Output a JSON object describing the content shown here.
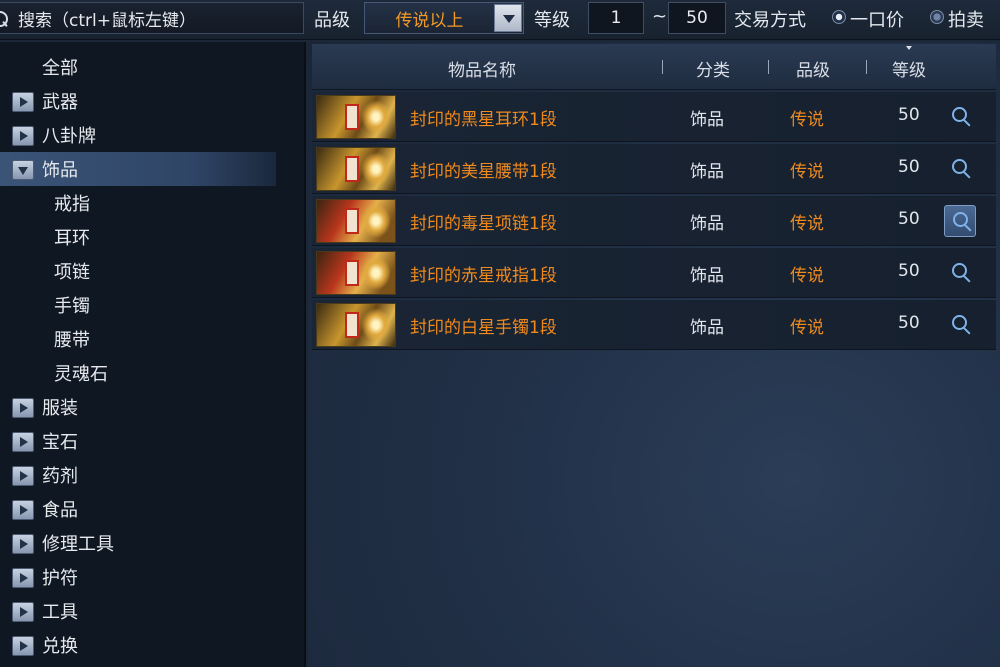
{
  "search": {
    "placeholder": "搜索（ctrl+鼠标左键）"
  },
  "filters": {
    "grade_label": "品级",
    "grade_value": "传说以上",
    "level_label": "等级",
    "level_min": "1",
    "level_sep": "~",
    "level_max": "50",
    "trade_label": "交易方式",
    "trade_options": [
      {
        "label": "一口价",
        "selected": true
      },
      {
        "label": "拍卖",
        "selected": false
      }
    ]
  },
  "sidebar": {
    "items": [
      {
        "label": "全部",
        "type": "root",
        "expanded": false
      },
      {
        "label": "武器",
        "type": "category",
        "expanded": false
      },
      {
        "label": "八卦牌",
        "type": "category",
        "expanded": false
      },
      {
        "label": "饰品",
        "type": "category",
        "expanded": true,
        "selected": true
      },
      {
        "label": "戒指",
        "type": "sub"
      },
      {
        "label": "耳环",
        "type": "sub"
      },
      {
        "label": "项链",
        "type": "sub"
      },
      {
        "label": "手镯",
        "type": "sub"
      },
      {
        "label": "腰带",
        "type": "sub"
      },
      {
        "label": "灵魂石",
        "type": "sub"
      },
      {
        "label": "服装",
        "type": "category",
        "expanded": false
      },
      {
        "label": "宝石",
        "type": "category",
        "expanded": false
      },
      {
        "label": "药剂",
        "type": "category",
        "expanded": false
      },
      {
        "label": "食品",
        "type": "category",
        "expanded": false
      },
      {
        "label": "修理工具",
        "type": "category",
        "expanded": false
      },
      {
        "label": "护符",
        "type": "category",
        "expanded": false
      },
      {
        "label": "工具",
        "type": "category",
        "expanded": false
      },
      {
        "label": "兑换",
        "type": "category",
        "expanded": false
      }
    ]
  },
  "table": {
    "headers": {
      "name": "物品名称",
      "category": "分类",
      "grade": "品级",
      "level": "等级"
    },
    "rows": [
      {
        "name": "封印的黑星耳环1段",
        "category": "饰品",
        "grade": "传说",
        "level": "50",
        "thumb": "gold"
      },
      {
        "name": "封印的美星腰带1段",
        "category": "饰品",
        "grade": "传说",
        "level": "50",
        "thumb": "gold"
      },
      {
        "name": "封印的毒星项链1段",
        "category": "饰品",
        "grade": "传说",
        "level": "50",
        "thumb": "red",
        "hovered": true
      },
      {
        "name": "封印的赤星戒指1段",
        "category": "饰品",
        "grade": "传说",
        "level": "50",
        "thumb": "red"
      },
      {
        "name": "封印的白星手镯1段",
        "category": "饰品",
        "grade": "传说",
        "level": "50",
        "thumb": "gold"
      }
    ]
  },
  "colors": {
    "legendary": "#f08a1c",
    "selected_bg": "#3a5477"
  }
}
